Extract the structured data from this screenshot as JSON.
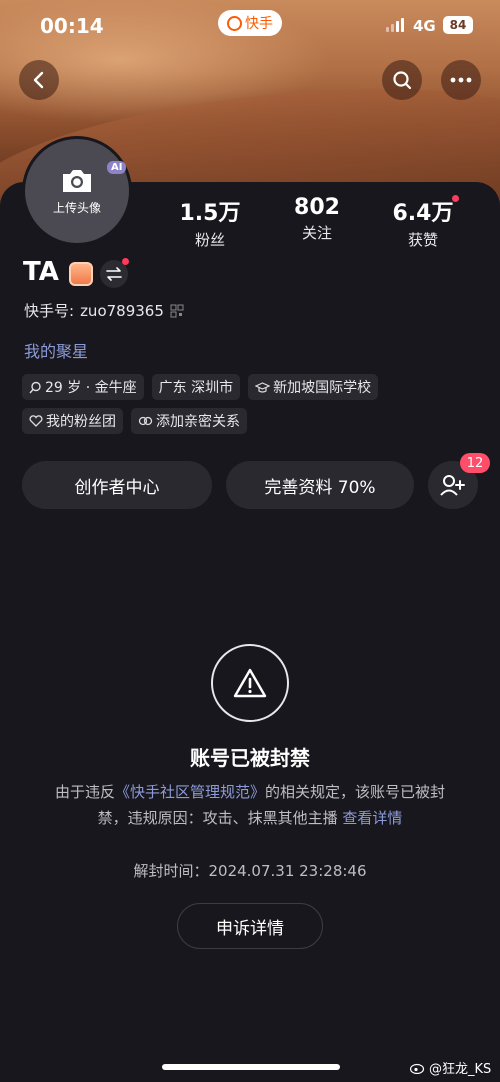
{
  "status_bar": {
    "time": "00:14",
    "app_name": "快手",
    "network": "4G",
    "battery": "84"
  },
  "header": {
    "back_icon": "chevron-left-icon",
    "search_icon": "search-icon",
    "more_icon": "more-icon"
  },
  "avatar": {
    "label": "上传头像",
    "ai_badge": "AI",
    "icon": "camera-icon"
  },
  "stats": [
    {
      "value": "1.5万",
      "label": "粉丝"
    },
    {
      "value": "802",
      "label": "关注"
    },
    {
      "value": "6.4万",
      "label": "获赞"
    }
  ],
  "profile": {
    "nickname": "TA",
    "kuaishou_id_label": "快手号:",
    "kuaishou_id": "zuo789365",
    "star_link": "我的聚星"
  },
  "tags": [
    {
      "icon": "search-icon",
      "text": "29 岁 · 金牛座"
    },
    {
      "icon": "",
      "text": "广东 深圳市"
    },
    {
      "icon": "graduation-cap-icon",
      "text": "新加坡国际学校"
    },
    {
      "icon": "heart-icon",
      "text": "我的粉丝团"
    },
    {
      "icon": "link-icon",
      "text": "添加亲密关系"
    }
  ],
  "actions": {
    "creator_center": "创作者中心",
    "complete_profile": "完善资料 70%",
    "add_friend_badge": "12"
  },
  "ban_notice": {
    "title": "账号已被封禁",
    "desc_prefix": "由于违反",
    "rule_link": "《快手社区管理规范》",
    "desc_middle": "的相关规定，该账号已被封禁，违规原因：攻击、抹黑其他主播",
    "more_link": "查看详情",
    "unban_time": "解封时间：2024.07.31 23:28:46",
    "appeal_button": "申诉详情"
  },
  "watermark": "@狂龙_KS",
  "colors": {
    "accent_link": "#8c9bd8",
    "badge_red": "#ff4d6a",
    "panel_bg": "#18171d",
    "brand_orange": "#ff5a00"
  }
}
